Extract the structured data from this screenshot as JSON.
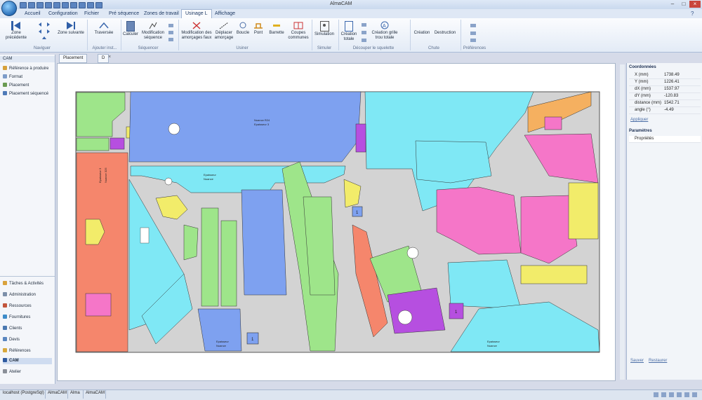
{
  "window": {
    "title": "AlmaCAM"
  },
  "tabs": [
    "Accueil",
    "Configuration",
    "Fichier",
    "Pré séquence",
    "Zones de travail",
    "Usinage L",
    "Affichage"
  ],
  "ribbon": {
    "buttons": {
      "zone_prev": "Zone précédente",
      "zone_next": "Zone suivante",
      "traversee": "Traversée",
      "calculer": "Calculer",
      "modif_seq": "Modification séquence",
      "modif_amorcages": "Modification des amorçages faux",
      "deplacer": "Déplacer amorçage",
      "boucle": "Boucle",
      "pont": "Pont",
      "barrette": "Barrette",
      "coupes": "Coupes communes",
      "simulation": "Simulation",
      "creation_totale": "Création totale",
      "creation_grille": "Création grille trou totale",
      "creation": "Création",
      "destruction": "Destruction"
    },
    "groups": {
      "naviguer": "Naviguer",
      "ajouter": "Ajouter inst...",
      "sequencer": "Séquencer",
      "usiner": "Usiner",
      "simuler": "Simuler",
      "decouper": "Découper le squelette",
      "chute": "Chute",
      "preferences": "Préférences"
    }
  },
  "doc_tabs": [
    "Placement",
    "D"
  ],
  "left_panel": {
    "header": "CAM",
    "top_items": [
      "Référence à produire",
      "Format",
      "Placement",
      "Placement séquencé"
    ],
    "bottom_items": [
      "Tâches & Activités",
      "Administration",
      "Ressources",
      "Fournitures",
      "Clients",
      "Devis",
      "Références",
      "CAM",
      "Atelier"
    ]
  },
  "coordinates": {
    "header": "Coordonnées",
    "rows": [
      {
        "label": "X  (mm)",
        "value": "1738.49"
      },
      {
        "label": "Y  (mm)",
        "value": "1226.41"
      },
      {
        "label": "dX (mm)",
        "value": "1537.97"
      },
      {
        "label": "dY (mm)",
        "value": "-120.83"
      },
      {
        "label": "distance (mm)",
        "value": "1542.71"
      },
      {
        "label": "angle (°)",
        "value": "-4.49"
      }
    ],
    "apply": "Appliquer"
  },
  "parameters": {
    "header": "Paramètres",
    "row": "Propriétés",
    "save": "Sauver",
    "restore": "Restaurer"
  },
  "sheet_labels": {
    "large_part": "Nuance R24",
    "large_part_2": "Epaisseur 3",
    "vertical": "Epaisseur 3",
    "vertical_2": "Nuance 325",
    "small": "Epaisseur",
    "small_2": "Nuance",
    "one": "1"
  },
  "status_bar": [
    "localhost (PostgreSql)",
    "AlmaCAM",
    "Alma",
    "AlmaCAM"
  ]
}
